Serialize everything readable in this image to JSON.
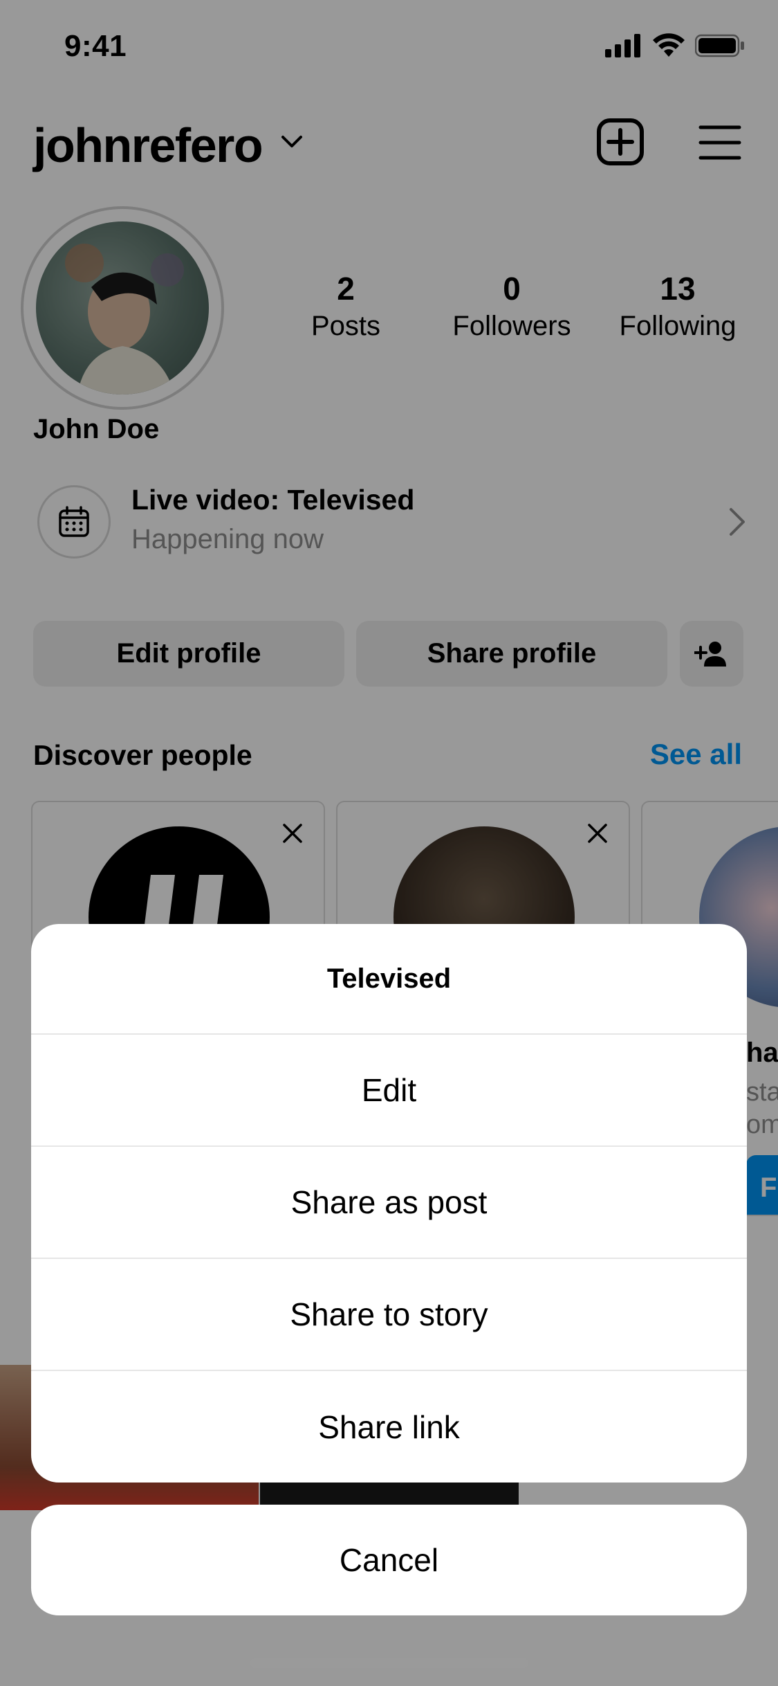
{
  "status_bar": {
    "time": "9:41",
    "signal_icon": "cellular-signal-icon",
    "wifi_icon": "wifi-icon",
    "battery_icon": "battery-icon"
  },
  "header": {
    "username": "johnrefero",
    "chevron_icon": "chevron-down-icon",
    "new_post_icon": "plus-square-icon",
    "menu_icon": "hamburger-menu-icon"
  },
  "profile": {
    "display_name": "John Doe",
    "stats": [
      {
        "value": "2",
        "label": "Posts"
      },
      {
        "value": "0",
        "label": "Followers"
      },
      {
        "value": "13",
        "label": "Following"
      }
    ]
  },
  "live": {
    "title": "Live video: Televised",
    "subtitle": "Happening now",
    "icon": "calendar-icon"
  },
  "buttons": {
    "edit_profile": "Edit profile",
    "share_profile": "Share profile",
    "add_person_icon": "add-person-icon"
  },
  "discover": {
    "title": "Discover people",
    "see_all": "See all",
    "cards": [
      {
        "name": "",
        "sub1": "",
        "sub2": ""
      },
      {
        "name": "",
        "sub1": "",
        "sub2": ""
      },
      {
        "name": "ha",
        "sub1": "sta",
        "sub2": "om",
        "follow": "Fo"
      }
    ]
  },
  "action_sheet": {
    "title": "Televised",
    "options": [
      "Edit",
      "Share as post",
      "Share to story",
      "Share link"
    ],
    "cancel": "Cancel"
  },
  "colors": {
    "accent": "#0095f6",
    "overlay": "rgba(0,0,0,0.40)",
    "sheet_bg": "#ffffff"
  }
}
